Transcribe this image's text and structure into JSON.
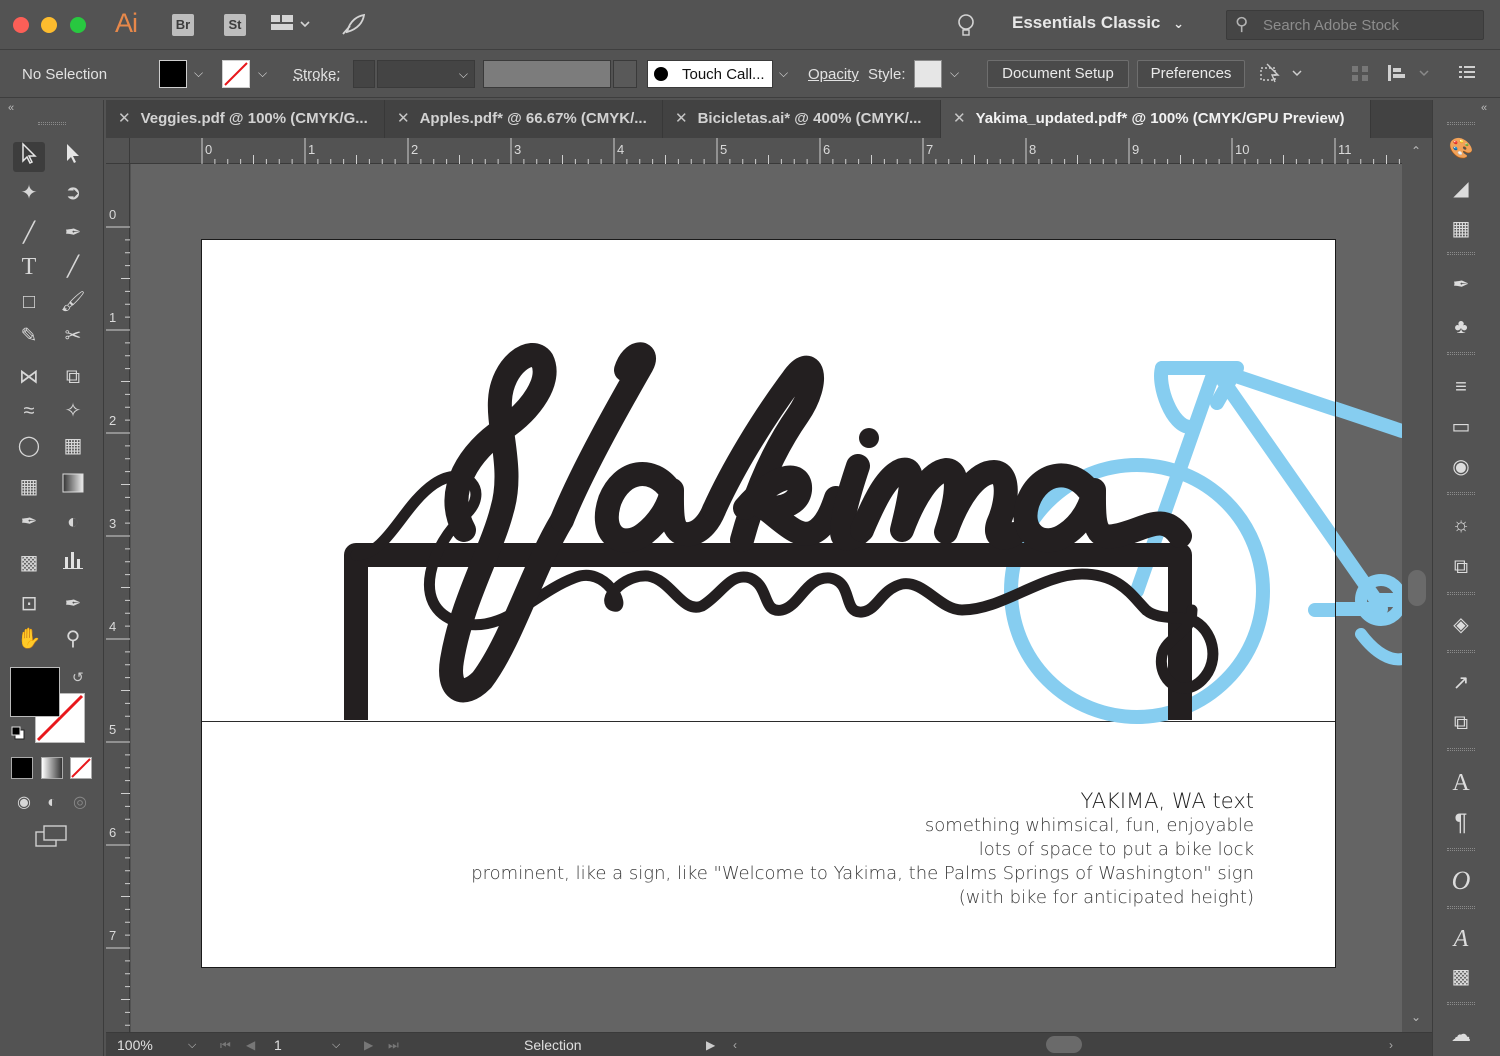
{
  "app": {
    "logo": "Ai",
    "bridge_badge": "Br",
    "stock_badge": "St",
    "workspace": "Essentials Classic",
    "search_placeholder": "Search Adobe Stock"
  },
  "control_bar": {
    "selection_label": "No Selection",
    "stroke_label": "Stroke:",
    "brush_label": "Touch Call...",
    "opacity_label": "Opacity",
    "style_label": "Style:",
    "document_setup": "Document Setup",
    "preferences": "Preferences"
  },
  "tabs": [
    {
      "label": "Veggies.pdf @ 100% (CMYK/G..."
    },
    {
      "label": "Apples.pdf* @ 66.67% (CMYK/..."
    },
    {
      "label": "Bicicletas.ai* @ 400% (CMYK/..."
    },
    {
      "label": "Yakima_updated.pdf* @ 100% (CMYK/GPU Preview)"
    }
  ],
  "ruler": {
    "horizontal": [
      "0",
      "1",
      "2",
      "3",
      "4",
      "5",
      "6",
      "7",
      "8",
      "9",
      "10",
      "11"
    ],
    "vertical": [
      "0",
      "1",
      "2",
      "3",
      "4",
      "5",
      "6",
      "7"
    ]
  },
  "artboard": {
    "lettering": "Yakima",
    "notes": {
      "heading": "YAKIMA, WA text",
      "lines": [
        "something whimsical, fun, enjoyable",
        "lots of space to put a bike lock",
        "prominent, like a sign, like \"Welcome to Yakima, the Palms Springs of Washington\" sign",
        "(with bike for anticipated height)"
      ]
    }
  },
  "status_bar": {
    "zoom": "100%",
    "page": "1",
    "mode": "Selection"
  },
  "colors": {
    "bike": "#86cdf0",
    "lettering": "#231f20",
    "ai_logo": "#e7884a"
  }
}
